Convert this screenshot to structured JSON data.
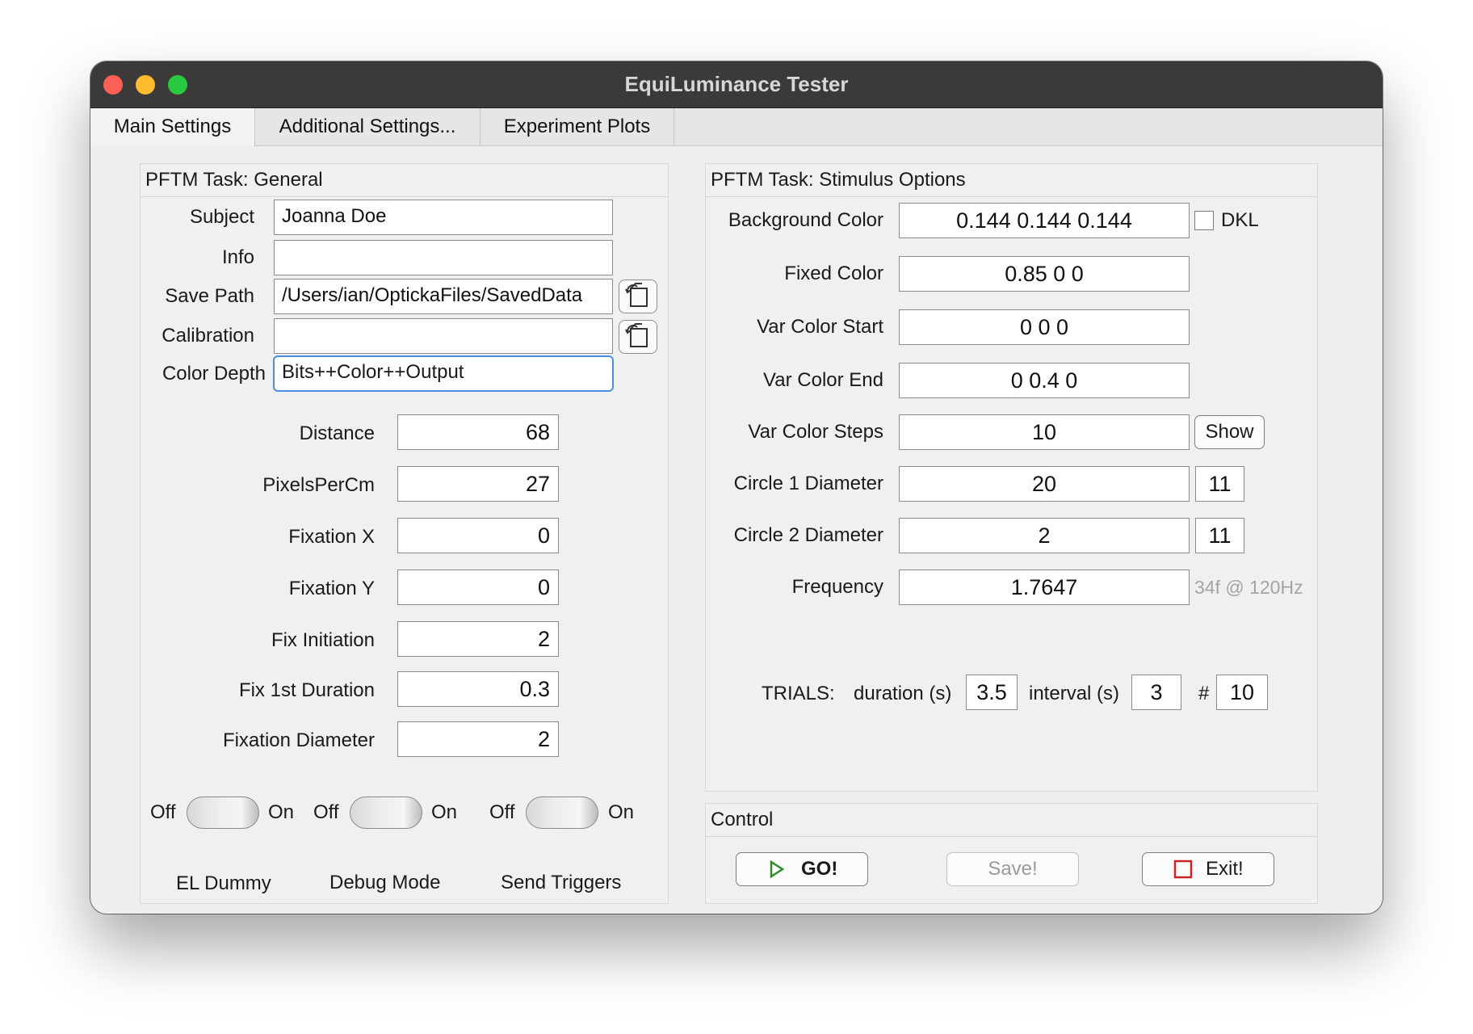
{
  "window": {
    "title": "EquiLuminance Tester"
  },
  "tabs": [
    {
      "label": "Main Settings"
    },
    {
      "label": "Additional Settings..."
    },
    {
      "label": "Experiment Plots"
    }
  ],
  "general": {
    "title": "PFTM Task: General",
    "subject": {
      "label": "Subject",
      "value": "Joanna Doe"
    },
    "info": {
      "label": "Info",
      "value": ""
    },
    "save_path": {
      "label": "Save Path",
      "value": "/Users/ian/OptickaFiles/SavedData"
    },
    "calibration": {
      "label": "Calibration",
      "value": ""
    },
    "color_depth": {
      "label": "Color Depth",
      "value": "Bits++Color++Output"
    },
    "numeric": [
      {
        "label": "Distance",
        "value": "68"
      },
      {
        "label": "PixelsPerCm",
        "value": "27"
      },
      {
        "label": "Fixation X",
        "value": "0"
      },
      {
        "label": "Fixation Y",
        "value": "0"
      },
      {
        "label": "Fix Initiation",
        "value": "2"
      },
      {
        "label": "Fix 1st Duration",
        "value": "0.3"
      },
      {
        "label": "Fixation Diameter",
        "value": "2"
      }
    ],
    "switches": [
      {
        "off": "Off",
        "on": "On",
        "name": "EL Dummy"
      },
      {
        "off": "Off",
        "on": "On",
        "name": "Debug Mode"
      },
      {
        "off": "Off",
        "on": "On",
        "name": "Send Triggers"
      }
    ]
  },
  "stimulus": {
    "title": "PFTM Task: Stimulus Options",
    "background_color": {
      "label": "Background Color",
      "value": "0.144 0.144 0.144"
    },
    "dkl_label": "DKL",
    "fixed_color": {
      "label": "Fixed Color",
      "value": "0.85 0 0"
    },
    "var_color_start": {
      "label": "Var Color Start",
      "value": "0 0 0"
    },
    "var_color_end": {
      "label": "Var Color End",
      "value": "0 0.4 0"
    },
    "var_color_steps": {
      "label": "Var Color Steps",
      "value": "10"
    },
    "show_label": "Show",
    "circle1": {
      "label": "Circle 1 Diameter",
      "value": "20",
      "extra": "11"
    },
    "circle2": {
      "label": "Circle 2 Diameter",
      "value": "2",
      "extra": "11"
    },
    "frequency": {
      "label": "Frequency",
      "value": "1.7647",
      "hint": "34f @ 120Hz"
    },
    "trials": {
      "label": "TRIALS:",
      "duration_label": "duration (s)",
      "duration": "3.5",
      "interval_label": "interval (s)",
      "interval": "3",
      "count_label": "#",
      "count": "10"
    }
  },
  "control": {
    "title": "Control",
    "go": "GO!",
    "save": "Save!",
    "exit": "Exit!"
  },
  "colors": {
    "accent": "#4a90e2",
    "go_icon": "#2e8b2e",
    "exit_icon": "#cc2222"
  }
}
